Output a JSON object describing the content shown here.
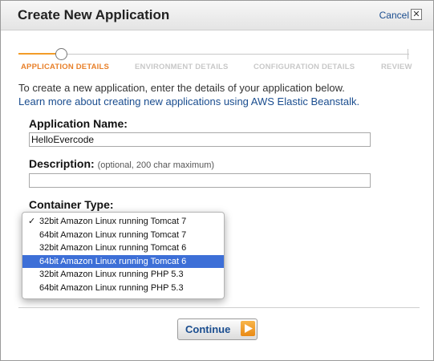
{
  "dialog": {
    "title": "Create New Application",
    "cancel_label": "Cancel",
    "close_glyph": "✕"
  },
  "steps": [
    {
      "label": "APPLICATION DETAILS",
      "active": true
    },
    {
      "label": "ENVIRONMENT DETAILS",
      "active": false
    },
    {
      "label": "CONFIGURATION DETAILS",
      "active": false
    },
    {
      "label": "REVIEW",
      "active": false
    }
  ],
  "intro": {
    "text": "To create a new application, enter the details of your application below.",
    "link": "Learn more about creating new applications using AWS Elastic Beanstalk."
  },
  "form": {
    "app_name_label": "Application Name:",
    "app_name_value": "HelloEvercode",
    "description_label": "Description:",
    "description_hint": "(optional, 200 char maximum)",
    "description_value": "",
    "container_label": "Container Type:"
  },
  "container_options": [
    {
      "label": "32bit Amazon Linux running Tomcat 7",
      "checked": true,
      "highlighted": false
    },
    {
      "label": "64bit Amazon Linux running Tomcat 7",
      "checked": false,
      "highlighted": false
    },
    {
      "label": "32bit Amazon Linux running Tomcat 6",
      "checked": false,
      "highlighted": false
    },
    {
      "label": "64bit Amazon Linux running Tomcat 6",
      "checked": false,
      "highlighted": true
    },
    {
      "label": "32bit Amazon Linux running PHP 5.3",
      "checked": false,
      "highlighted": false
    },
    {
      "label": "64bit Amazon Linux running PHP 5.3",
      "checked": false,
      "highlighted": false
    }
  ],
  "check_glyph": "✓",
  "footer": {
    "continue_label": "Continue"
  },
  "colors": {
    "accent": "#e8802a",
    "link": "#1a4d8f",
    "highlight": "#3d6fd7"
  },
  "icons": {
    "continue_arrow": "play-arrow-icon",
    "close": "close-icon"
  }
}
